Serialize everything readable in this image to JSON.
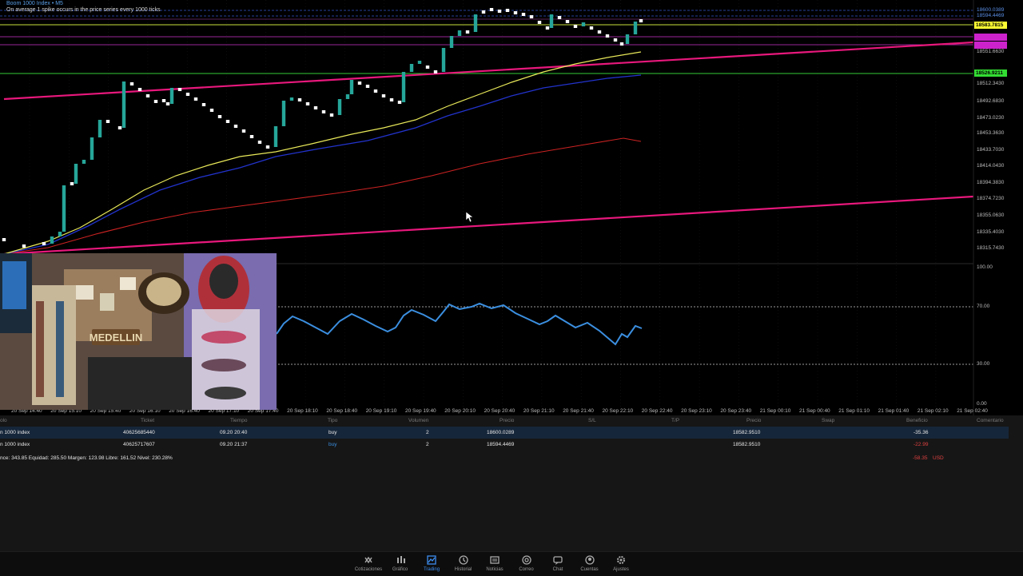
{
  "chart": {
    "symbol_line": "Boom 1000 Index • M5",
    "description_line": "On average 1 spike occurs in the price series every 1000 ticks",
    "price_labels": [
      "18600.0389",
      "18594.4469",
      "18551.6630",
      "18512.3430",
      "18492.6830",
      "18473.0230",
      "18453.3630",
      "18433.7030",
      "18414.0430",
      "18394.3830",
      "18374.7230",
      "18355.0630",
      "18335.4030",
      "18315.7430"
    ],
    "price_tags": [
      {
        "text": "18583.7815",
        "bg": "#ffff33",
        "fg": "#000000"
      },
      {
        "text": "18526.9211",
        "bg": "#33dd33",
        "fg": "#000000"
      }
    ],
    "indicator_levels": [
      "100.00",
      "70.00",
      "30.00",
      "0.00"
    ],
    "time_labels": [
      "20 Sep 14:40",
      "20 Sep 15:10",
      "20 Sep 15:40",
      "20 Sep 16:10",
      "20 Sep 16:40",
      "20 Sep 17:10",
      "20 Sep 17:40",
      "20 Sep 18:10",
      "20 Sep 18:40",
      "20 Sep 19:10",
      "20 Sep 19:40",
      "20 Sep 20:10",
      "20 Sep 20:40",
      "20 Sep 21:10",
      "20 Sep 21:40",
      "20 Sep 22:10",
      "20 Sep 22:40",
      "20 Sep 23:10",
      "20 Sep 23:40",
      "21 Sep 00:10",
      "21 Sep 00:40",
      "21 Sep 01:10",
      "21 Sep 01:40",
      "21 Sep 02:10",
      "21 Sep 02:40"
    ],
    "colors": {
      "bull": "#26a69a",
      "bear": "#ffffff",
      "ma_fast": "#e8e85a",
      "ma_mid": "#2233cc",
      "ma_slow": "#cc2222",
      "trendline": "#e8187c",
      "rsi": "#3b8fe0"
    }
  },
  "webcam": {
    "sign_text": "MEDELLIN"
  },
  "positions": {
    "columns": [
      "olo",
      "Ticket",
      "Tiempo",
      "Tipo",
      "Volumen",
      "Precio",
      "S/L",
      "T/P",
      "Precio",
      "Swap",
      "Beneficio",
      "Comentario"
    ],
    "rows": [
      {
        "symbol": "n 1000 index",
        "ticket": "40625685440",
        "time": "09.20 20:40",
        "type": "buy",
        "volume": "2",
        "open_price": "18600.0289",
        "current_price": "18582.9510",
        "profit": "-35.36"
      },
      {
        "symbol": "n 1000 index",
        "ticket": "40625717607",
        "time": "09.20 21:37",
        "type": "buy",
        "volume": "2",
        "open_price": "18594.4469",
        "current_price": "18582.9510",
        "profit": "-22.99"
      }
    ],
    "summary": "nce: 343.85 Equidad: 285.50 Margen: 123.98 Libre: 161.52 Nivel: 230.28%",
    "total_profit": "-58.35",
    "currency": "USD"
  },
  "nav": {
    "active": "Trading",
    "items": [
      {
        "label": "Cotizaciones",
        "icon": "quotes-icon"
      },
      {
        "label": "Gráfico",
        "icon": "chart-icon"
      },
      {
        "label": "Trading",
        "icon": "trading-icon"
      },
      {
        "label": "Historial",
        "icon": "history-icon"
      },
      {
        "label": "Noticias",
        "icon": "news-icon"
      },
      {
        "label": "Correo",
        "icon": "mail-icon"
      },
      {
        "label": "Chat",
        "icon": "chat-icon"
      },
      {
        "label": "Cuentas",
        "icon": "accounts-icon"
      },
      {
        "label": "Ajustes",
        "icon": "settings-icon"
      }
    ]
  }
}
